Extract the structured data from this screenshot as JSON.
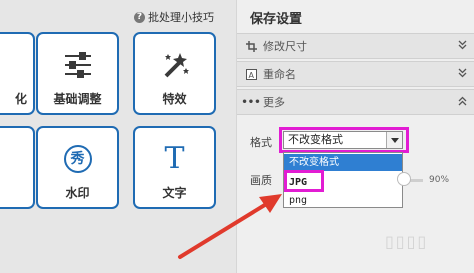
{
  "left": {
    "tips": "批处理小技巧",
    "tiles": {
      "cut_top": "化",
      "basic": "基础调整",
      "effects": "特效",
      "watermark": "水印",
      "watermark_glyph": "秀",
      "text": "文字",
      "text_glyph": "T"
    }
  },
  "panel": {
    "title": "保存设置",
    "sections": {
      "resize": "修改尺寸",
      "rename": "重命名",
      "more": "更多",
      "more_dots": "•••"
    },
    "format_label": "格式",
    "quality_label": "画质",
    "format_selected": "不改变格式",
    "format_options": [
      "不改变格式",
      "JPG",
      "png"
    ],
    "quality_value": "90%"
  },
  "colors": {
    "highlight": "#e21cd3",
    "arrow": "#e03a2c",
    "tile_border": "#1f6bb3",
    "selected_option": "#2f7fd2"
  },
  "icons": [
    "help-icon",
    "sliders-icon",
    "magic-wand-icon",
    "crop-icon",
    "rename-icon",
    "chevron-double-down-icon",
    "dropdown-arrow-icon",
    "arrow-annotation"
  ]
}
